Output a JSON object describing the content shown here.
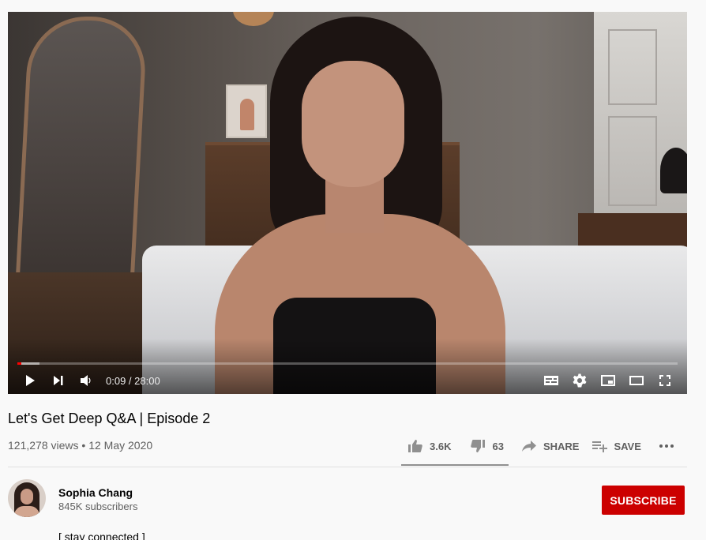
{
  "video": {
    "current_time": "0:09",
    "duration": "28:00",
    "time_separator": " / ",
    "progress_fraction": 0.0054,
    "buffered_fraction": 0.033
  },
  "player_controls": {
    "left": [
      "play-icon",
      "next-icon",
      "volume-icon"
    ],
    "right": [
      "subtitles-icon",
      "settings-icon",
      "miniplayer-icon",
      "theater-mode-icon",
      "fullscreen-icon"
    ]
  },
  "info": {
    "title": "Let's Get Deep Q&A | Episode 2",
    "views": "121,278 views",
    "date": "12 May 2020",
    "separator": " • "
  },
  "actions": {
    "like_count": "3.6K",
    "dislike_count": "63",
    "share_label": "SHARE",
    "save_label": "SAVE",
    "like_ratio": 0.98
  },
  "channel": {
    "name": "Sophia Chang",
    "subscribers": "845K subscribers",
    "subscribe_label": "SUBSCRIBE"
  },
  "description": {
    "first_line": "[ stay connected ]"
  },
  "colors": {
    "progress_played": "#ff0000",
    "subscribe_bg": "#cc0000",
    "page_bg": "#f9f9f9",
    "secondary_text": "#606060"
  }
}
